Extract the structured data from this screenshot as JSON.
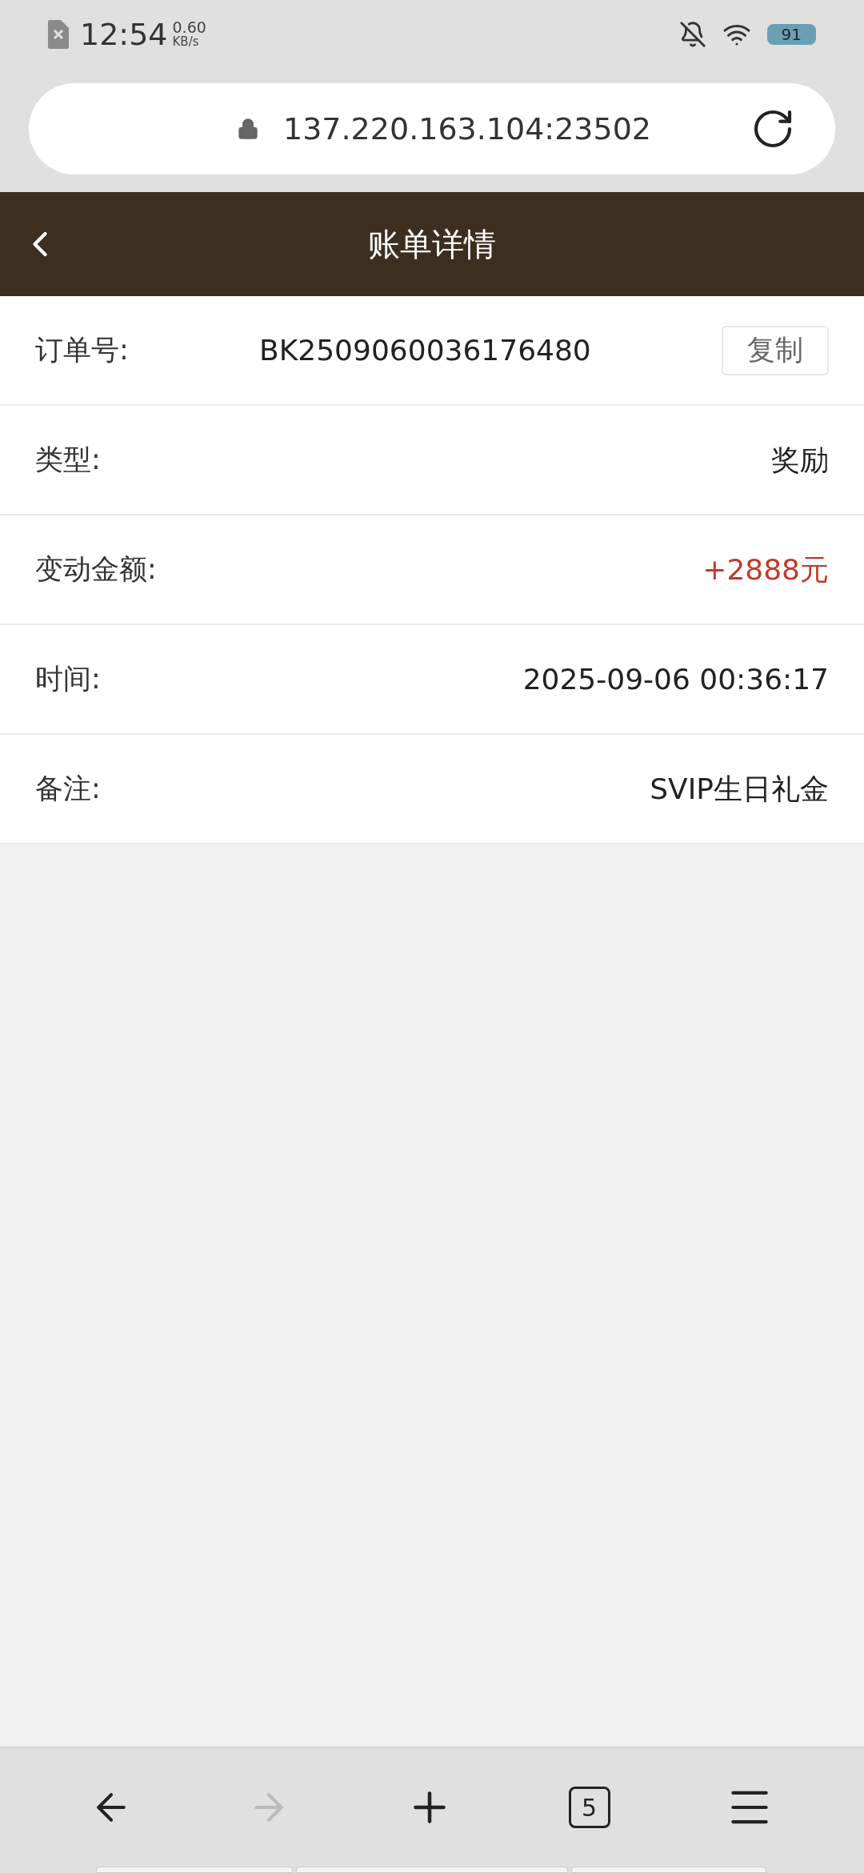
{
  "status_bar": {
    "time": "12:54",
    "speed": "0.60",
    "speed_unit": "KB/s",
    "battery": "91"
  },
  "address_bar": {
    "url": "137.220.163.104:23502"
  },
  "header": {
    "title": "账单详情"
  },
  "rows": [
    {
      "kind": "copy",
      "label": "订单号:",
      "value": "BK2509060036176480",
      "button": "复制"
    },
    {
      "kind": "plain",
      "label": "类型:",
      "value": "奖励"
    },
    {
      "kind": "amount",
      "label": "变动金额:",
      "value": "+2888元"
    },
    {
      "kind": "plain",
      "label": "时间:",
      "value": "2025-09-06 00:36:17"
    },
    {
      "kind": "plain",
      "label": "备注:",
      "value": "SVIP生日礼金"
    }
  ],
  "bottom_nav": {
    "tab_count": "5"
  }
}
